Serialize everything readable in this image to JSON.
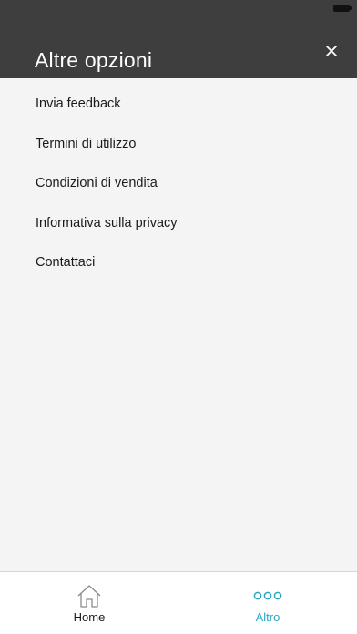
{
  "header": {
    "title": "Altre opzioni"
  },
  "menu": {
    "items": [
      {
        "label": "Invia feedback"
      },
      {
        "label": "Termini di utilizzo"
      },
      {
        "label": "Condizioni di vendita"
      },
      {
        "label": "Informativa sulla privacy"
      },
      {
        "label": "Contattaci"
      }
    ]
  },
  "tabbar": {
    "tabs": [
      {
        "label": "Home",
        "icon": "home-icon",
        "active": false
      },
      {
        "label": "Altro",
        "icon": "more-dots-icon",
        "active": true
      }
    ]
  },
  "colors": {
    "header_bg": "#3f3e3e",
    "accent": "#2aa7c1",
    "page_bg": "#f4f4f4"
  }
}
